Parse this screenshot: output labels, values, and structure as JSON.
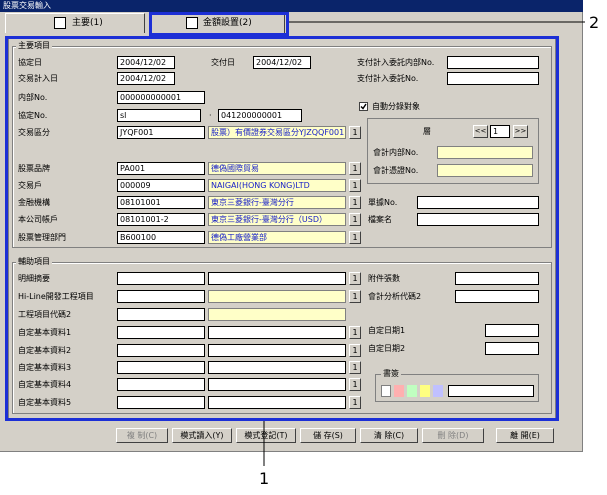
{
  "window": {
    "title": "股票交易輸入"
  },
  "tabs": [
    {
      "label": "主要(1)"
    },
    {
      "label": "金額設置(2)"
    }
  ],
  "main_group": {
    "title": "主要項目",
    "labels": {
      "agreement_date": "協定日",
      "transaction_date": "交易計入日",
      "internal_no": "内部No.",
      "agreement_no": "協定No.",
      "transaction_type": "交易區分",
      "stock_brand": "股票品牌",
      "trader": "交易戶",
      "financial_institution": "金融機構",
      "company_account": "本公司帳戶",
      "stock_dept": "股票管理部門",
      "delivery_date": "交付日",
      "payment_internal_no": "支付計入委託内部No.",
      "payment_no": "支付計入委託No.",
      "auto_split": "自動分錄對象",
      "page": "層",
      "acc_internal_no": "會計内部No.",
      "acc_voucher_no": "會計憑證No.",
      "ticket_no": "單據No.",
      "file_name": "檔案名"
    },
    "values": {
      "agreement_date": "2004/12/02",
      "transaction_date": "2004/12/02",
      "internal_no": "000000000001",
      "agreement_no_code": "sl",
      "agreement_no_num": "041200000001",
      "delivery_date": "2004/12/02",
      "transaction_type_code": "JYQF001",
      "transaction_type_name": "股票）有價證券交易區分YJZQQF001",
      "stock_brand_code": "PA001",
      "stock_brand_name": "德偽國際貿易",
      "trader_code": "000009",
      "trader_name": "NAIGAI(HONG KONG)LTD",
      "fin_code": "08101001",
      "fin_name": "東京三菱銀行-臺灣分行",
      "acct_code": "08101001-2",
      "acct_name": "東京三菱銀行-臺灣分行（USD）",
      "dept_code": "B600100",
      "dept_name": "德偽工廠營業部",
      "page_num": "1",
      "dot": "·"
    }
  },
  "aux_group": {
    "title": "輔助項目",
    "labels": {
      "detail": "明細摘要",
      "hiline": "Hi-Line開發工程項目",
      "project": "工程項目代碼2",
      "custom1": "自定基本資料1",
      "custom2": "自定基本資料2",
      "custom3": "自定基本資料3",
      "custom4": "自定基本資料4",
      "custom5": "自定基本資料5",
      "attachments": "附件張數",
      "acc_analysis": "會計分析代碼2",
      "custom_date1": "自定日期1",
      "custom_date2": "自定日期2",
      "colors": "書簽"
    }
  },
  "small_buttons": {
    "one": "1",
    "prev": "<<",
    "next": ">>"
  },
  "bottom_buttons": [
    {
      "label": "複 制(C)"
    },
    {
      "label": "模式讀入(Y)"
    },
    {
      "label": "模式登記(T)"
    },
    {
      "label": "儲 存(S)"
    },
    {
      "label": "清 除(C)"
    },
    {
      "label": "刪 除(D)"
    },
    {
      "label": "離 開(E)"
    }
  ],
  "callouts": {
    "one": "1",
    "two": "2"
  },
  "colors": {
    "frame": "#1c2fd6",
    "title": "#0a246a",
    "yellow": "#ffffc8",
    "swatches": [
      "#ffffff",
      "#ffb0b0",
      "#c0ffc0",
      "#ffff80",
      "#c0c0ff",
      "#ffffff"
    ]
  }
}
